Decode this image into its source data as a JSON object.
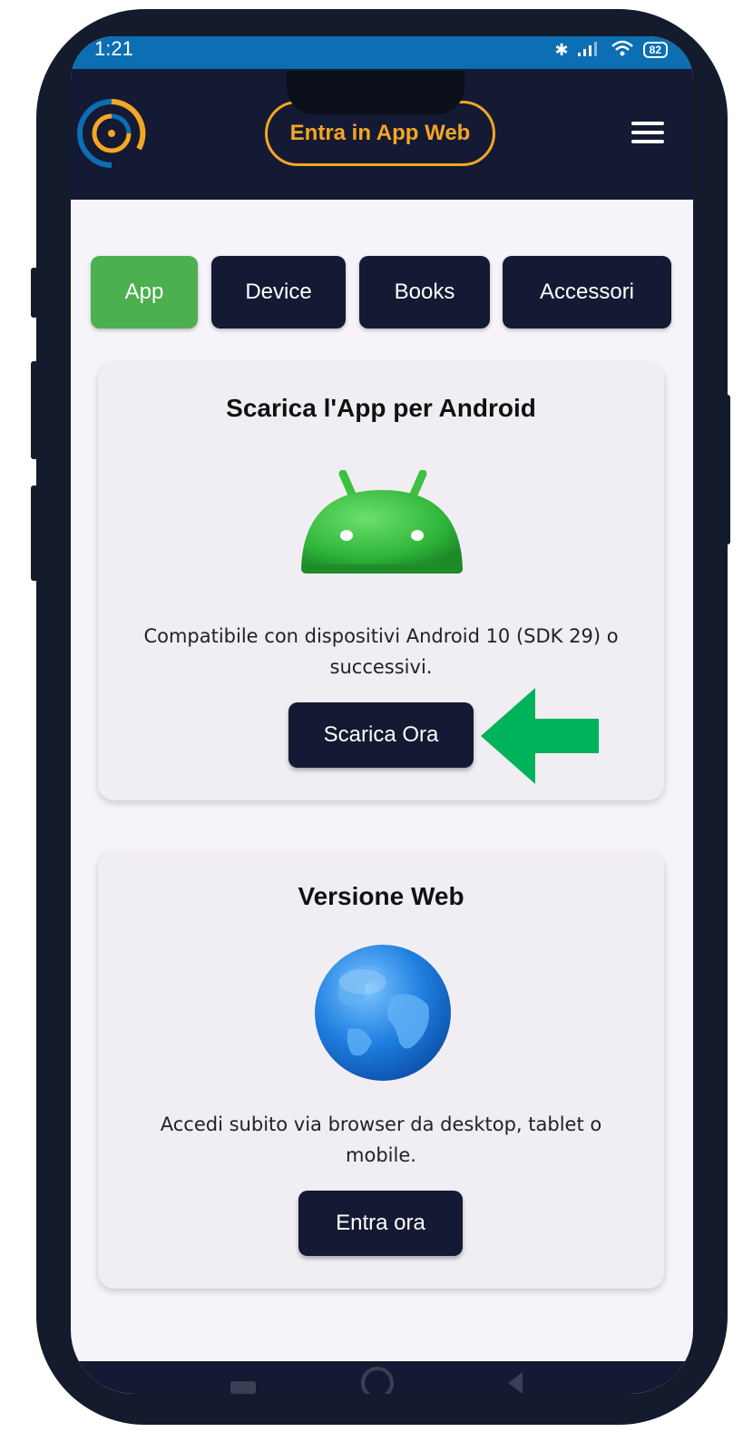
{
  "status_bar": {
    "time": "1:21",
    "icons": [
      "bluetooth-icon",
      "signal-icon",
      "wifi-icon"
    ],
    "battery": "82"
  },
  "header": {
    "logo": "app-logo",
    "web_app_button": "Entra in App Web",
    "menu_icon": "hamburger-menu-icon"
  },
  "tabs": [
    {
      "label": "App",
      "active": true
    },
    {
      "label": "Device",
      "active": false
    },
    {
      "label": "Books",
      "active": false
    },
    {
      "label": "Accessori",
      "active": false
    }
  ],
  "cards": {
    "android": {
      "title": "Scarica l'App per Android",
      "image": "android-robot-icon",
      "description": "Compatibile con dispositivi Android 10 (SDK 29) o successivi.",
      "button": "Scarica Ora"
    },
    "web": {
      "title": "Versione Web",
      "image": "globe-icon",
      "description": "Accedi subito via browser da desktop, tablet o mobile.",
      "button": "Entra ora"
    }
  },
  "annotation": {
    "arrow": "green-arrow-icon",
    "color": "#00b35a"
  },
  "colors": {
    "header_bg": "#141a33",
    "accent_orange": "#f5a623",
    "active_tab": "#4caf50",
    "status_bar": "#0c6eb3"
  }
}
